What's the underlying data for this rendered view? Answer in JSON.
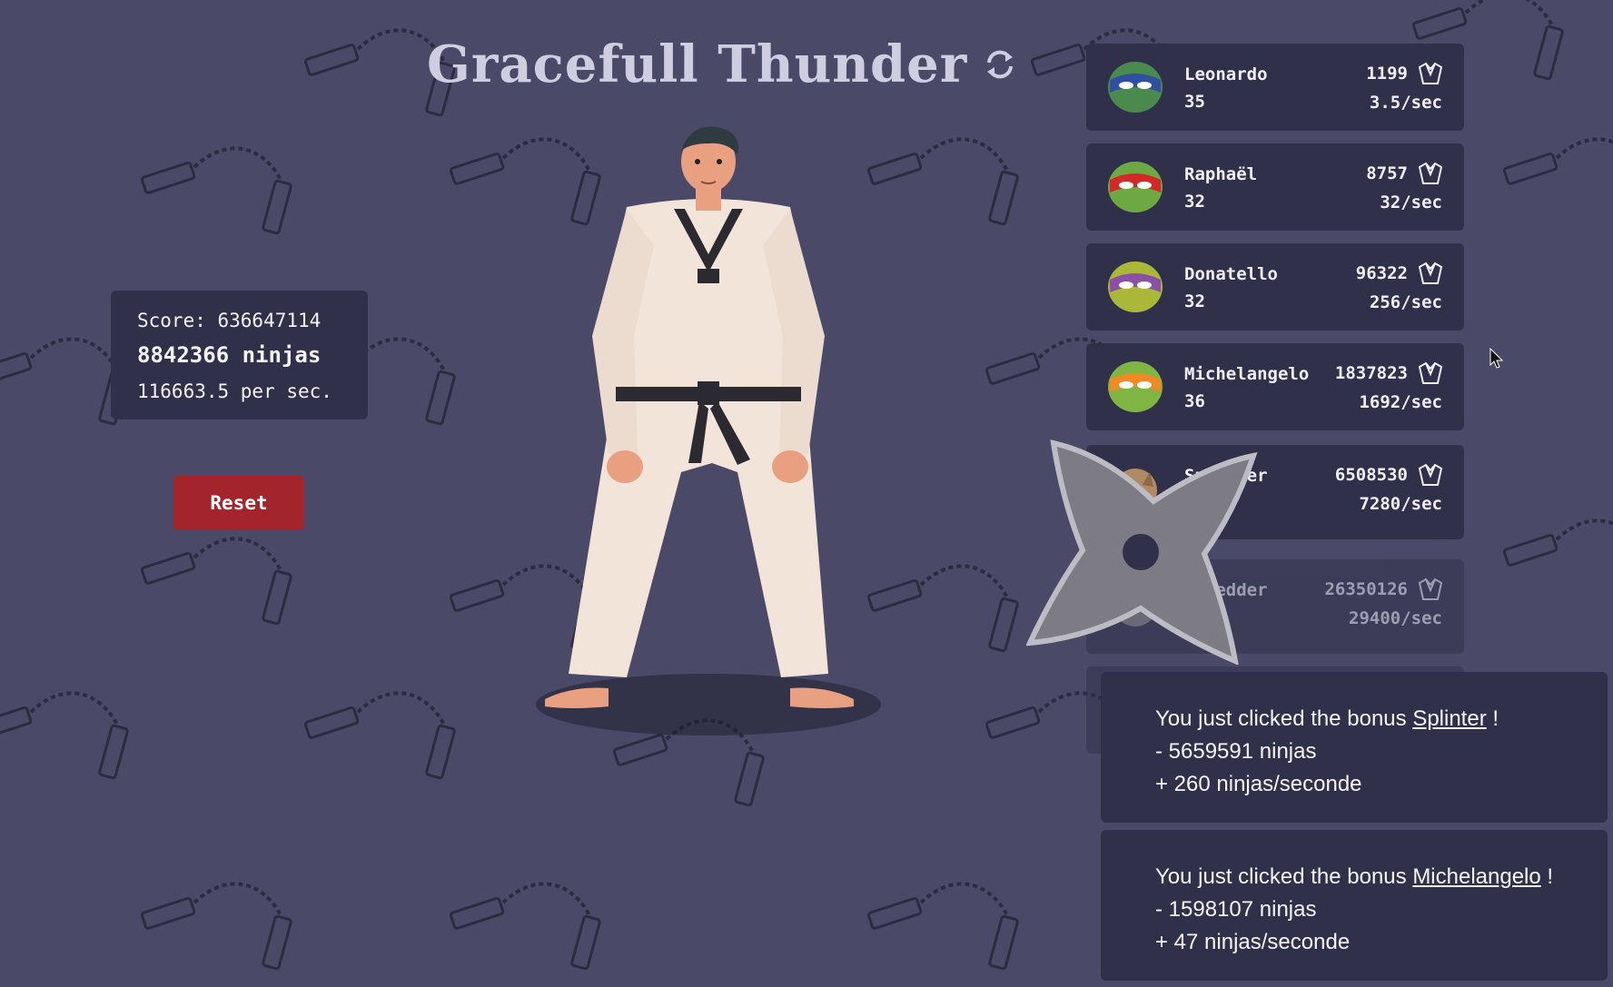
{
  "title": "Gracefull Thunder",
  "score": {
    "score_label": "Score: 636647114",
    "ninjas_label": "8842366 ninjas",
    "per_sec_label": "116663.5 per sec."
  },
  "reset_label": "Reset",
  "bonuses": [
    {
      "name": "Leonardo",
      "level": "35",
      "cost": "1199",
      "rate": "3.5/sec",
      "mask_color": "#2f4fa0",
      "skin_color": "#4b8a4e",
      "locked": false
    },
    {
      "name": "Raphaël",
      "level": "32",
      "cost": "8757",
      "rate": "32/sec",
      "mask_color": "#d42828",
      "skin_color": "#6ea843",
      "locked": false
    },
    {
      "name": "Donatello",
      "level": "32",
      "cost": "96322",
      "rate": "256/sec",
      "mask_color": "#8b4fa6",
      "skin_color": "#a9b838",
      "locked": false
    },
    {
      "name": "Michelangelo",
      "level": "36",
      "cost": "1837823",
      "rate": "1692/sec",
      "mask_color": "#f08a24",
      "skin_color": "#7fb542",
      "locked": false
    },
    {
      "name": "Splinter",
      "level": "",
      "cost": "6508530",
      "rate": "7280/sec",
      "mask_color": "#8a6a4a",
      "skin_color": "#b08a62",
      "locked": false
    },
    {
      "name": "Shredder",
      "level": "",
      "cost": "26350126",
      "rate": "29400/sec",
      "mask_color": "#777777",
      "skin_color": "#888888",
      "locked": true
    }
  ],
  "toasts": [
    {
      "prefix": "You just clicked the bonus ",
      "bonus": "Splinter",
      "suffix": " !",
      "line2": "- 5659591 ninjas",
      "line3": "+ 260 ninjas/seconde"
    },
    {
      "prefix": "You just clicked the bonus ",
      "bonus": "Michelangelo",
      "suffix": " !",
      "line2": "- 1598107 ninjas",
      "line3": "+ 47 ninjas/seconde"
    }
  ],
  "colors": {
    "background": "#4a4a68",
    "panel": "#30304a",
    "reset": "#a3242a",
    "pattern": "#2c2c40"
  },
  "icons": {
    "refresh": "refresh-icon",
    "cost": "gi-icon",
    "shuriken": "shuriken-icon"
  }
}
